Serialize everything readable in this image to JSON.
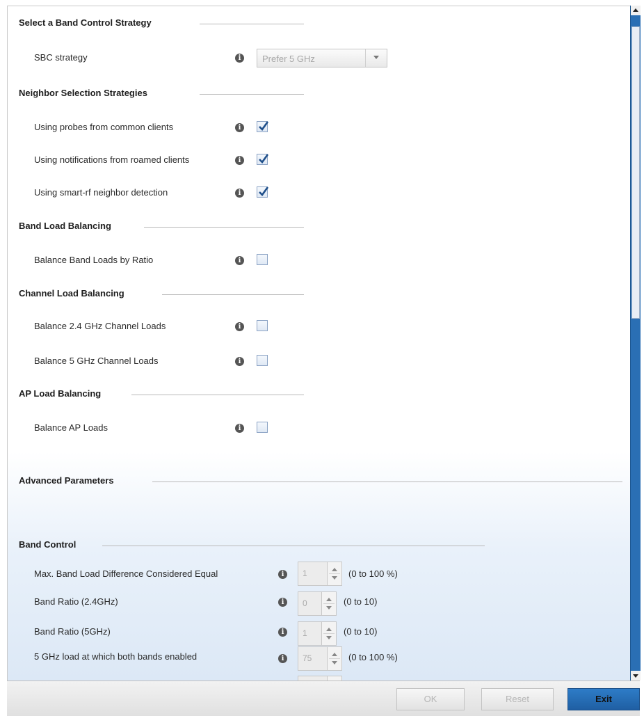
{
  "sections": {
    "band_control_strategy": "Select a Band Control Strategy",
    "neighbor_selection": "Neighbor Selection Strategies",
    "band_load_balancing": "Band Load Balancing",
    "channel_load_balancing": "Channel Load Balancing",
    "ap_load_balancing": "AP Load Balancing",
    "advanced_parameters": "Advanced Parameters",
    "band_control": "Band Control"
  },
  "sbc": {
    "label": "SBC strategy",
    "selected": "Prefer 5 GHz"
  },
  "neighbor": {
    "probes_label": "Using probes from common clients",
    "probes_checked": true,
    "notifications_label": "Using notifications from roamed clients",
    "notifications_checked": true,
    "smartrf_label": "Using smart-rf neighbor detection",
    "smartrf_checked": true
  },
  "band_lb": {
    "ratio_label": "Balance Band Loads by Ratio",
    "ratio_checked": false
  },
  "channel_lb": {
    "ch24_label": "Balance 2.4 GHz Channel Loads",
    "ch24_checked": false,
    "ch5_label": "Balance 5 GHz Channel Loads",
    "ch5_checked": false
  },
  "ap_lb": {
    "ap_label": "Balance AP Loads",
    "ap_checked": false
  },
  "band_control": {
    "max_diff_label": "Max. Band Load Difference Considered Equal",
    "max_diff_value": "1",
    "max_diff_range": "(0 to 100 %)",
    "ratio24_label": "Band Ratio (2.4GHz)",
    "ratio24_value": "0",
    "ratio24_range": "(0 to 10)",
    "ratio5_label": "Band Ratio (5GHz)",
    "ratio5_value": "1",
    "ratio5_range": "(0 to 10)",
    "load5_label": "5 GHz load at which both bands enabled",
    "load5_value": "75",
    "load5_range": "(0 to 100 %)"
  },
  "buttons": {
    "ok": "OK",
    "reset": "Reset",
    "exit": "Exit"
  },
  "info_glyph": "i",
  "colors": {
    "accent": "#2a6fb4",
    "checkmark": "#1f4f8a"
  }
}
